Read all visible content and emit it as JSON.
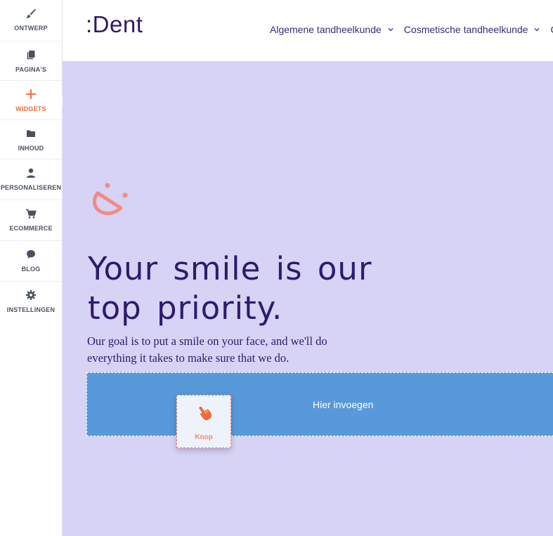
{
  "sidebar": {
    "items": [
      {
        "label": "ONTWERP",
        "icon": "brush-icon"
      },
      {
        "label": "PAGINA'S",
        "icon": "pages-icon"
      },
      {
        "label": "WIDGETS",
        "icon": "plus-icon",
        "active": true
      },
      {
        "label": "INHOUD",
        "icon": "folder-icon"
      },
      {
        "label": "PERSONALISEREN",
        "icon": "person-icon"
      },
      {
        "label": "ECOMMERCE",
        "icon": "cart-icon"
      },
      {
        "label": "BLOG",
        "icon": "chat-bubble-icon"
      },
      {
        "label": "INSTELLINGEN",
        "icon": "gear-icon"
      }
    ]
  },
  "site": {
    "logo": ":Dent",
    "nav": [
      {
        "label": "Algemene tandheelkunde"
      },
      {
        "label": "Cosmetische tandheelkunde"
      },
      {
        "label": "C"
      }
    ]
  },
  "hero": {
    "title": "Your smile is our top priority.",
    "text": "Our goal is to put a smile on your face, and we'll do everything it takes to make sure that we do."
  },
  "dropzone": {
    "label": "Hier invoegen"
  },
  "drag_widget": {
    "label": "Knop",
    "icon": "pointing-hand-icon"
  },
  "colors": {
    "accent": "#ef6b3a",
    "brand": "#2f1a6b",
    "hero_background": "#d6d3f5",
    "dropzone": "#5899da",
    "smile_logo": "#f38a85"
  }
}
